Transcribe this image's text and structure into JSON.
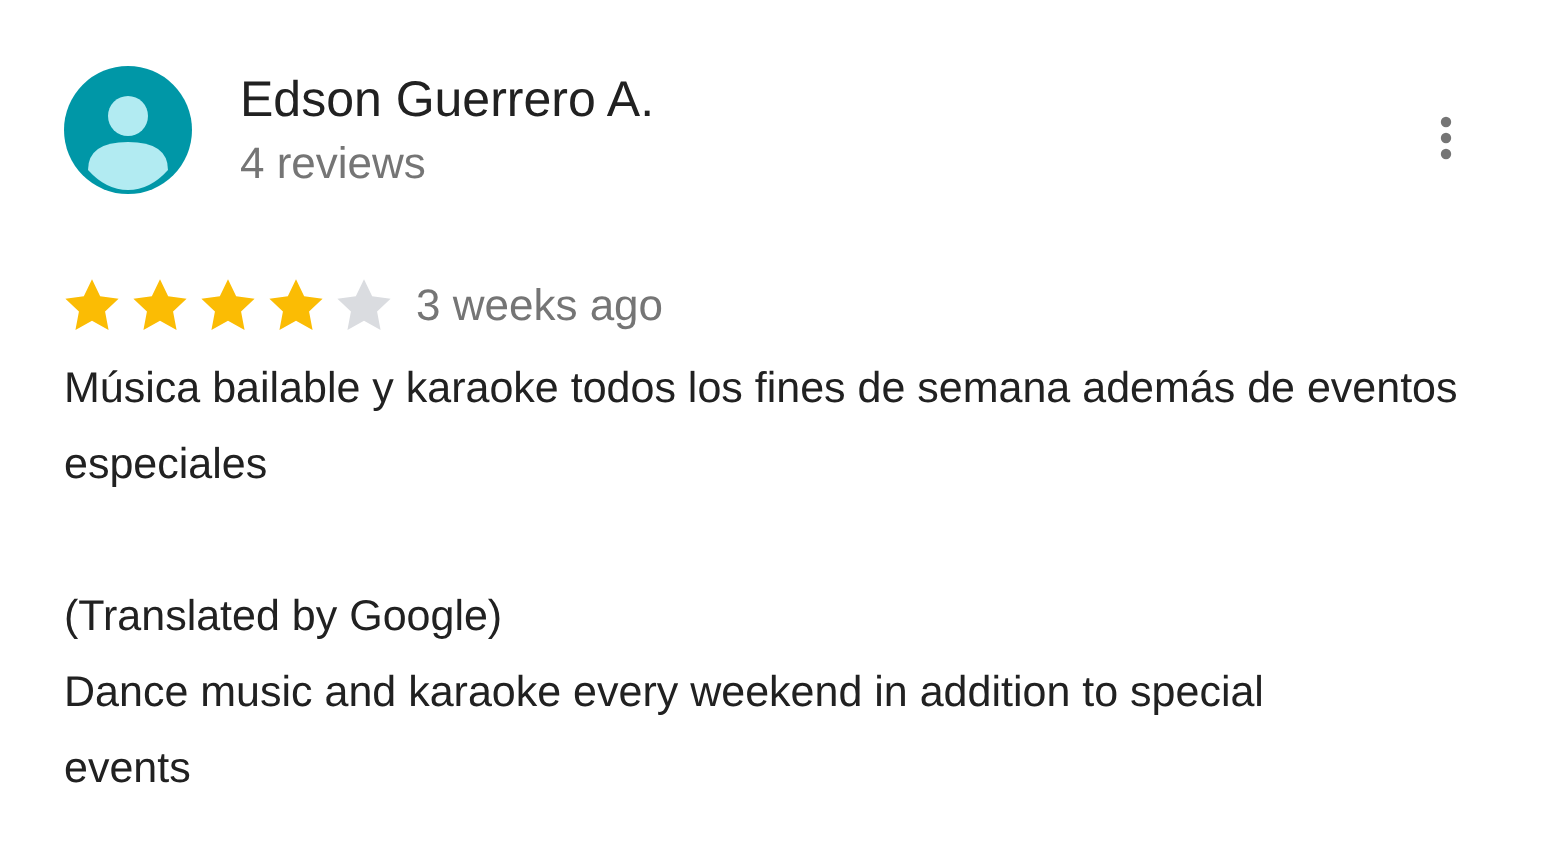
{
  "reviewer": {
    "name": "Edson Guerrero A.",
    "review_count": "4 reviews"
  },
  "rating": {
    "stars": 4
  },
  "time": "3 weeks ago",
  "review_text": "Música bailable y karaoke todos los fines de semana además de eventos especiales",
  "translation_label": "(Translated by Google)",
  "translated_text": "Dance music and karaoke every weekend in addition to special events"
}
